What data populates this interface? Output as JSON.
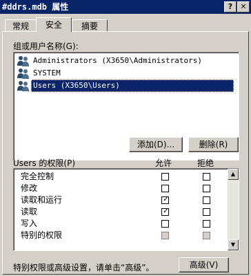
{
  "window": {
    "title": "#ddrs.mdb 属性",
    "help_glyph": "?",
    "close_glyph": "✕"
  },
  "tabs": [
    {
      "label": "常规"
    },
    {
      "label": "安全"
    },
    {
      "label": "摘要"
    }
  ],
  "groups": {
    "label": "组或用户名称(G):",
    "items": [
      {
        "name": "Administrators (X3650\\Administrators)",
        "icon": "user-group-icon",
        "selected": false
      },
      {
        "name": "SYSTEM",
        "icon": "user-group-icon",
        "selected": false
      },
      {
        "name": "Users (X3650\\Users)",
        "icon": "user-group-icon",
        "selected": true
      }
    ]
  },
  "buttons": {
    "add": "添加(D)...",
    "remove": "删除(R)",
    "advanced": "高级(V)"
  },
  "permissions": {
    "header": "Users 的权限(P)",
    "allow_label": "允许",
    "deny_label": "拒绝",
    "rows": [
      {
        "name": "完全控制",
        "allow": false,
        "deny": false,
        "disabled": false
      },
      {
        "name": "修改",
        "allow": false,
        "deny": false,
        "disabled": false
      },
      {
        "name": "读取和运行",
        "allow": true,
        "deny": false,
        "disabled": false
      },
      {
        "name": "读取",
        "allow": true,
        "deny": false,
        "disabled": false
      },
      {
        "name": "写入",
        "allow": false,
        "deny": false,
        "disabled": false
      },
      {
        "name": "特别的权限",
        "allow": false,
        "deny": false,
        "disabled": true
      }
    ]
  },
  "footer_text": "特别权限或高级设置，请单击“高级”。",
  "colors": {
    "titlebar": "#0a246a",
    "selection": "#0a246a",
    "face": "#d4d0c8"
  }
}
